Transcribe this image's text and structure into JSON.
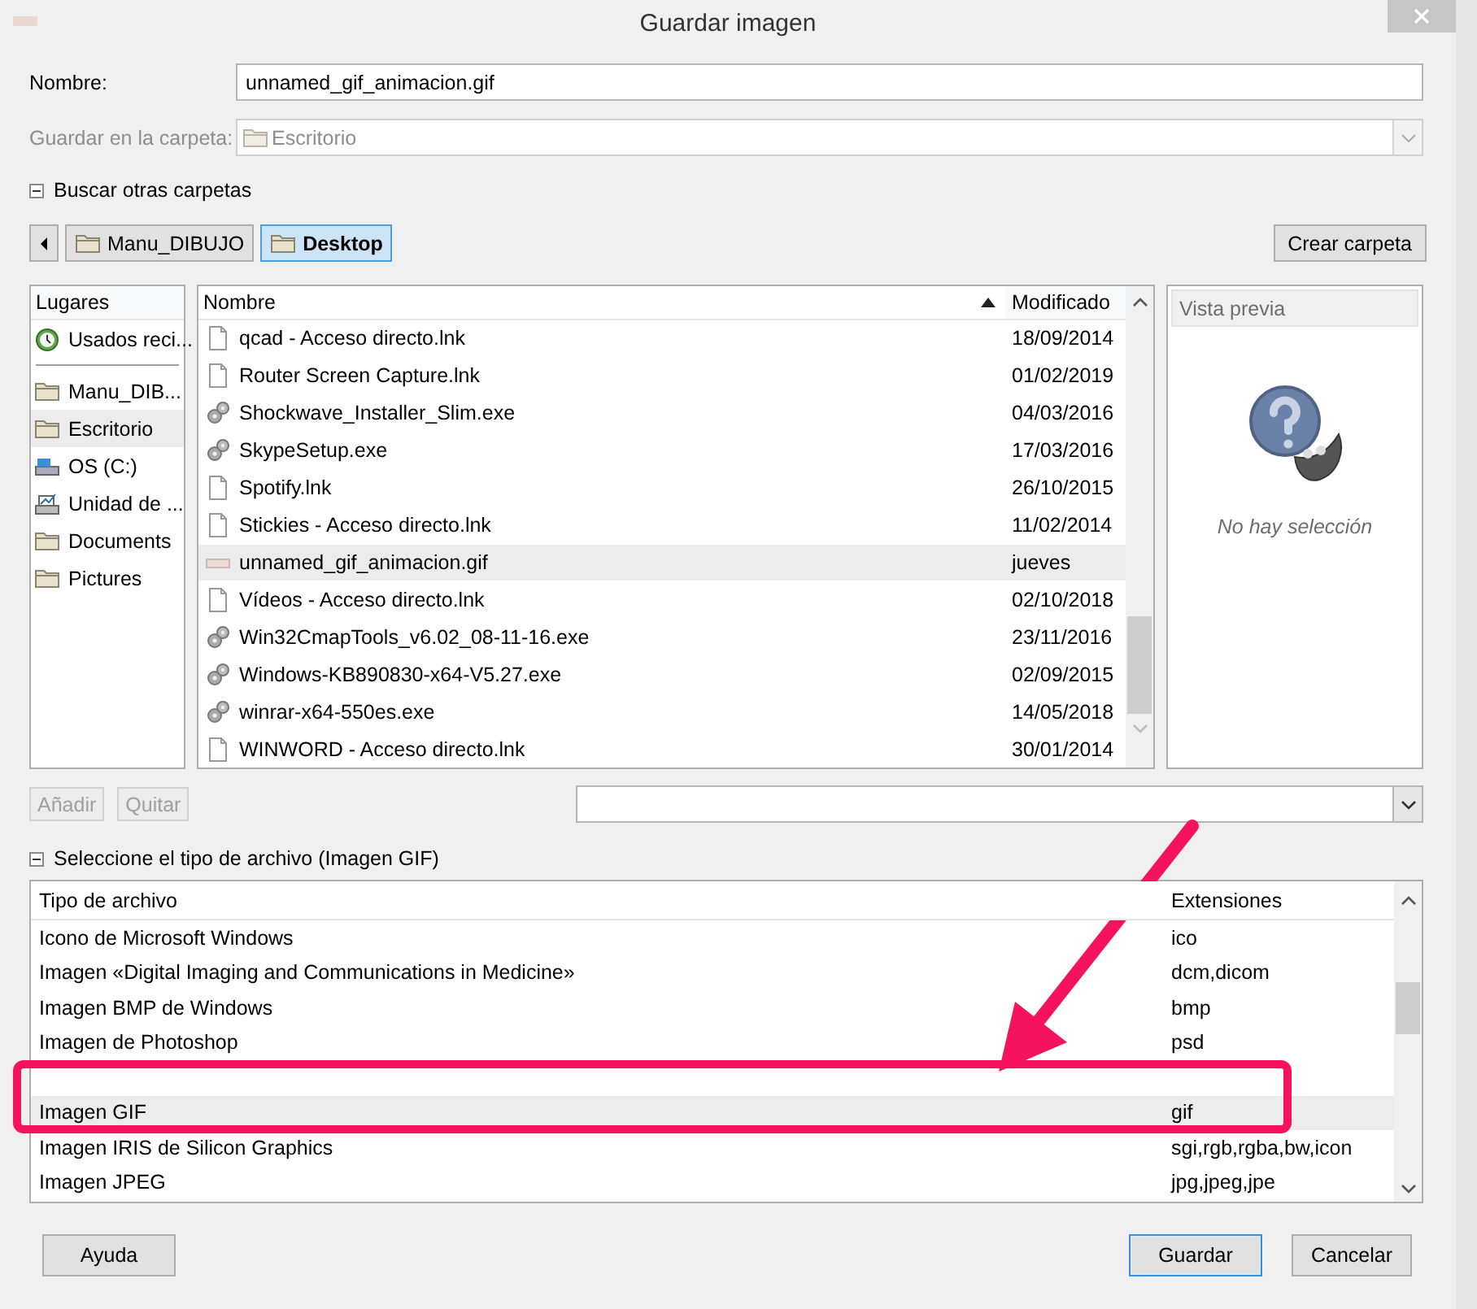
{
  "window": {
    "title": "Guardar imagen"
  },
  "name_field": {
    "label": "Nombre:",
    "value": "unnamed_gif_animacion.gif"
  },
  "folder_field": {
    "label": "Guardar en la carpeta:",
    "value": "Escritorio",
    "disabled": true
  },
  "browse_toggle": {
    "label": "Buscar otras carpetas",
    "expanded": true
  },
  "path_bar": [
    {
      "label": "Manu_DIBUJO",
      "selected": false
    },
    {
      "label": "Desktop",
      "selected": true
    }
  ],
  "create_folder_button": "Crear carpeta",
  "places": {
    "header": "Lugares",
    "items": [
      {
        "label": "Usados reci...",
        "kind": "recent",
        "selected": false
      },
      {
        "label": "Manu_DIB...",
        "kind": "folder",
        "selected": false
      },
      {
        "label": "Escritorio",
        "kind": "folder",
        "selected": true
      },
      {
        "label": "OS (C:)",
        "kind": "drive",
        "selected": false
      },
      {
        "label": "Unidad de ...",
        "kind": "removable",
        "selected": false
      },
      {
        "label": "Documents",
        "kind": "folder",
        "selected": false
      },
      {
        "label": "Pictures",
        "kind": "folder",
        "selected": false
      }
    ]
  },
  "files": {
    "columns": [
      {
        "label": "Nombre",
        "sorted": true
      },
      {
        "label": "Modificado",
        "sorted": false
      }
    ],
    "rows": [
      {
        "name": "qcad - Acceso directo.lnk",
        "modified": "18/09/2014",
        "kind": "document",
        "selected": false
      },
      {
        "name": "Router Screen Capture.lnk",
        "modified": "01/02/2019",
        "kind": "document",
        "selected": false
      },
      {
        "name": "Shockwave_Installer_Slim.exe",
        "modified": "04/03/2016",
        "kind": "program",
        "selected": false
      },
      {
        "name": "SkypeSetup.exe",
        "modified": "17/03/2016",
        "kind": "program",
        "selected": false
      },
      {
        "name": "Spotify.lnk",
        "modified": "26/10/2015",
        "kind": "document",
        "selected": false
      },
      {
        "name": "Stickies - Acceso directo.lnk",
        "modified": "11/02/2014",
        "kind": "document",
        "selected": false
      },
      {
        "name": "unnamed_gif_animacion.gif",
        "modified": "jueves",
        "kind": "image",
        "selected": true
      },
      {
        "name": "Vídeos - Acceso directo.lnk",
        "modified": "02/10/2018",
        "kind": "document",
        "selected": false
      },
      {
        "name": "Win32CmapTools_v6.02_08-11-16.exe",
        "modified": "23/11/2016",
        "kind": "program",
        "selected": false
      },
      {
        "name": "Windows-KB890830-x64-V5.27.exe",
        "modified": "02/09/2015",
        "kind": "program",
        "selected": false
      },
      {
        "name": "winrar-x64-550es.exe",
        "modified": "14/05/2018",
        "kind": "program",
        "selected": false
      },
      {
        "name": "WINWORD - Acceso directo.lnk",
        "modified": "30/01/2014",
        "kind": "document",
        "selected": false
      }
    ]
  },
  "preview": {
    "header": "Vista previa",
    "message": "No hay selección"
  },
  "add_button": {
    "label": "Añadir",
    "disabled": true
  },
  "remove_button": {
    "label": "Quitar",
    "disabled": true
  },
  "filetype_toggle": {
    "label": "Seleccione el tipo de archivo (Imagen GIF)",
    "expanded": true
  },
  "filetypes": {
    "columns": [
      "Tipo de archivo",
      "Extensiones"
    ],
    "rows": [
      {
        "type": "Icono de Microsoft Windows",
        "extensions": "ico",
        "selected": false
      },
      {
        "type": "Imagen «Digital Imaging and Communications in Medicine»",
        "extensions": "dcm,dicom",
        "selected": false
      },
      {
        "type": "Imagen BMP de Windows",
        "extensions": "bmp",
        "selected": false
      },
      {
        "type": "Imagen de Photoshop",
        "extensions": "psd",
        "selected": false
      },
      {
        "obscured": true,
        "selected": false
      },
      {
        "type": "Imagen GIF",
        "extensions": "gif",
        "selected": true
      },
      {
        "type": "Imagen IRIS de Silicon Graphics",
        "extensions": "sgi,rgb,rgba,bw,icon",
        "selected": false
      },
      {
        "type": "Imagen JPEG",
        "extensions": "jpg,jpeg,jpe",
        "selected": false
      }
    ]
  },
  "buttons": [
    {
      "label": "Ayuda",
      "kind": "help"
    },
    {
      "label": "Guardar",
      "kind": "default"
    },
    {
      "label": "Cancelar",
      "kind": "normal"
    }
  ]
}
